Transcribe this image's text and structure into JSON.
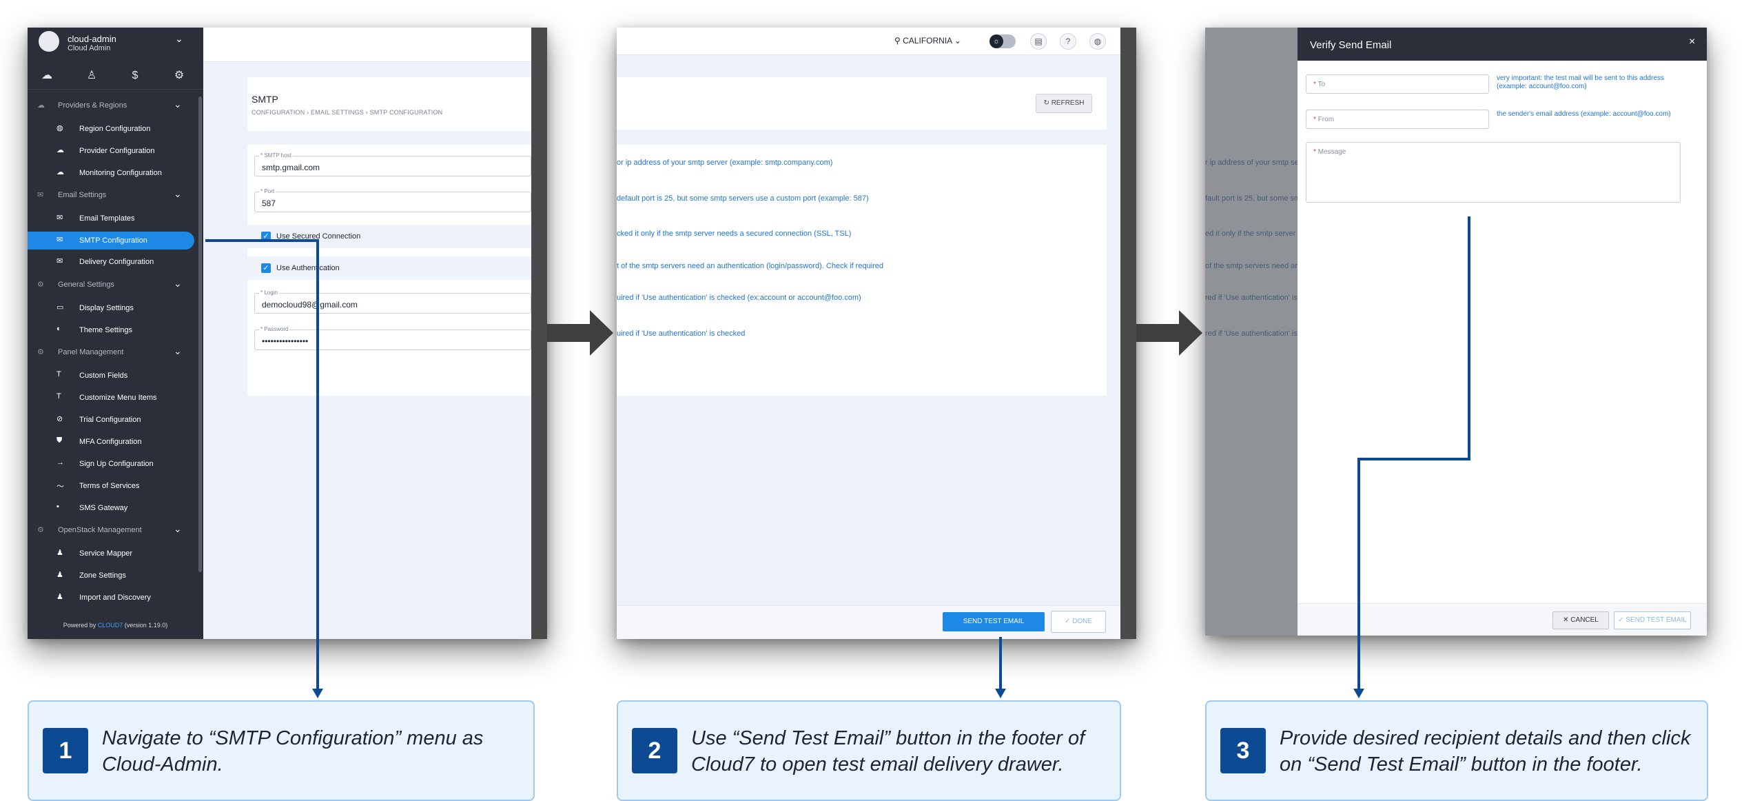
{
  "panel1": {
    "user": {
      "name": "cloud-admin",
      "role": "Cloud Admin"
    },
    "sidebar_groups": {
      "providers": "Providers & Regions",
      "email": "Email Settings",
      "general": "General Settings",
      "panel": "Panel Management",
      "openstack": "OpenStack Management"
    },
    "sidebar_items": [
      "Region Configuration",
      "Provider Configuration",
      "Monitoring Configuration",
      "Email Templates",
      "SMTP Configuration",
      "Delivery Configuration",
      "Display Settings",
      "Theme Settings",
      "Custom Fields",
      "Customize Menu Items",
      "Trial Configuration",
      "MFA Configuration",
      "Sign Up Configuration",
      "Terms of Services",
      "SMS Gateway",
      "Service Mapper",
      "Zone Settings",
      "Import and Discovery"
    ],
    "footer": {
      "prefix": "Powered by ",
      "brand": "CLOUD7",
      "version": " (version 1.19.0)"
    },
    "page_title": "SMTP",
    "breadcrumb": "CONFIGURATION  ›  EMAIL SETTINGS  ›  SMTP CONFIGURATION",
    "fields": {
      "host_label": "* SMTP host",
      "host_value": "smtp.gmail.com",
      "port_label": "* Port",
      "port_value": "587",
      "secured_label": "Use Secured Connection",
      "auth_label": "Use Authentication",
      "login_label": "* Login",
      "login_value": "democloud98@gmail.com",
      "password_label": "* Password",
      "password_value": "••••••••••••••••"
    }
  },
  "panel2": {
    "location": "CALIFORNIA",
    "refresh_label": "REFRESH",
    "hints": [
      "or ip address of your smtp server (example: smtp.company.com)",
      "default port is 25, but some smtp servers use a custom port (example: 587)",
      "cked it only if the smtp server needs a secured connection (SSL, TSL)",
      "t of the smtp servers need an authentication (login/password). Check if required",
      "uired if 'Use authentication' is checked (ex:account or account@foo.com)",
      "uired if 'Use authentication' is checked"
    ],
    "send_test_label": "SEND TEST EMAIL",
    "done_label": "DONE"
  },
  "panel3": {
    "bg_hints": [
      "r ip address of your smtp se",
      "fault port is 25, but some sm",
      "ed it only if the smtp server n",
      "of the smtp servers need an a",
      "red if 'Use authentication' is c",
      "red if 'Use authentication' is c"
    ],
    "drawer_title": "Verify Send Email",
    "close": "×",
    "to_label": "To",
    "to_hint": "very important: the test mail will be sent to this address (example: account@foo.com)",
    "from_label": "From",
    "from_hint": "the sender's email address (example: account@foo.com)",
    "message_label": "Message",
    "cancel_label": "CANCEL",
    "send_label": "SEND TEST EMAIL"
  },
  "callouts": [
    {
      "num": "1",
      "text": "Navigate to “SMTP Configuration” menu as Cloud-Admin."
    },
    {
      "num": "2",
      "text": "Use “Send Test Email” button in the footer of Cloud7 to open test email delivery drawer."
    },
    {
      "num": "3",
      "text": "Provide desired recipient details and then click on “Send Test Email” button in the footer."
    }
  ],
  "colors": {
    "accent": "#1e88e5",
    "sidebar": "#2b2f3a",
    "arrow": "#0d4a94",
    "callout_bg": "#e9f3fd"
  }
}
